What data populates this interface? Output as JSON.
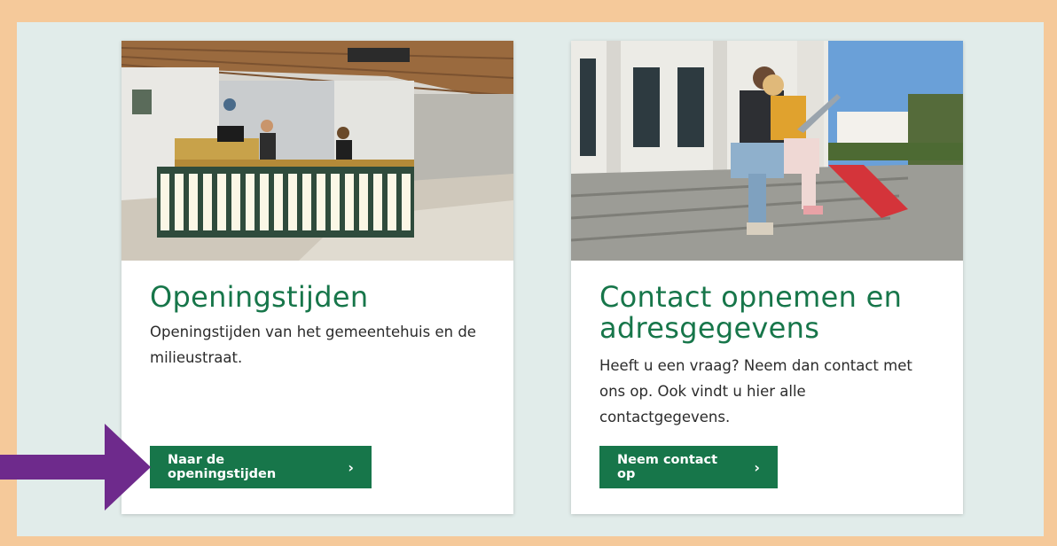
{
  "cards": [
    {
      "image": "reception-desk-photo",
      "title": "Openingstijden",
      "description": "Openingstijden van het gemeentehuis en de milieustraat.",
      "button_label": "Naar de openingstijden",
      "button_icon": "chevron-right-icon"
    },
    {
      "image": "people-on-steps-photo",
      "title": "Contact opnemen en adresgegevens",
      "description": "Heeft u een vraag? Neem dan contact met ons op. Ook vindt u hier alle contactgegevens.",
      "button_label": "Neem contact op",
      "button_icon": "chevron-right-icon"
    }
  ],
  "annotation": {
    "icon": "arrow-right-icon",
    "color": "#6e2a8c"
  },
  "colors": {
    "accent_green": "#17764a",
    "frame_border": "#f5c99a",
    "frame_background": "#e1ecea",
    "card_background": "#ffffff"
  }
}
